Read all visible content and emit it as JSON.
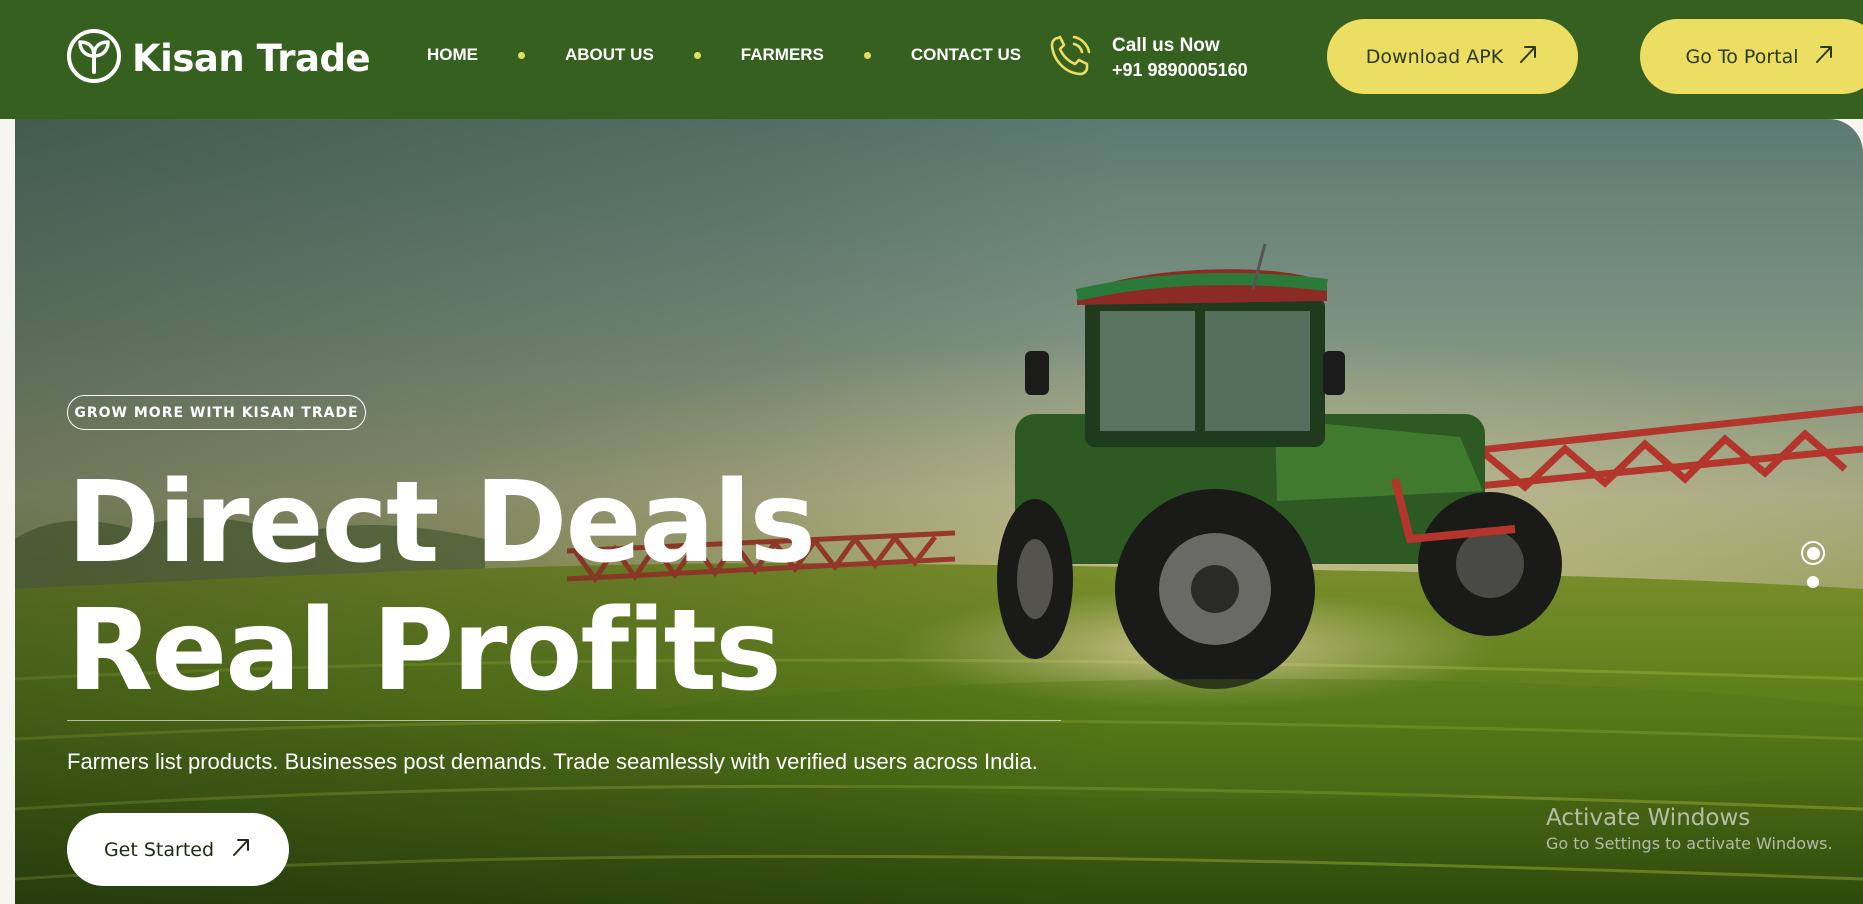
{
  "header": {
    "logo_text": "Kisan Trade",
    "nav": [
      {
        "label": "HOME"
      },
      {
        "label": "ABOUT US"
      },
      {
        "label": "FARMERS"
      },
      {
        "label": "CONTACT US"
      }
    ],
    "call_label": "Call us Now",
    "call_number": "+91 9890005160",
    "download_label": "Download APK",
    "portal_label": "Go To Portal"
  },
  "hero": {
    "tagline": "GROW MORE WITH KISAN TRADE",
    "headline_line1": "Direct Deals",
    "headline_line2": "Real Profits",
    "subtext": "Farmers list products. Businesses post demands. Trade seamlessly with verified users across India.",
    "cta_label": "Get Started",
    "slides_total": 2,
    "active_slide": 1
  },
  "watermark": {
    "title": "Activate Windows",
    "subtitle": "Go to Settings to activate Windows."
  },
  "icons": {
    "logo": "leaf-circle-icon",
    "phone": "phone-ringing-icon",
    "arrow": "arrow-up-right-icon"
  },
  "colors": {
    "header_bg": "#366020",
    "accent_yellow": "#ecde62",
    "nav_dot": "#e9dc5d",
    "text_white": "#ffffff"
  }
}
